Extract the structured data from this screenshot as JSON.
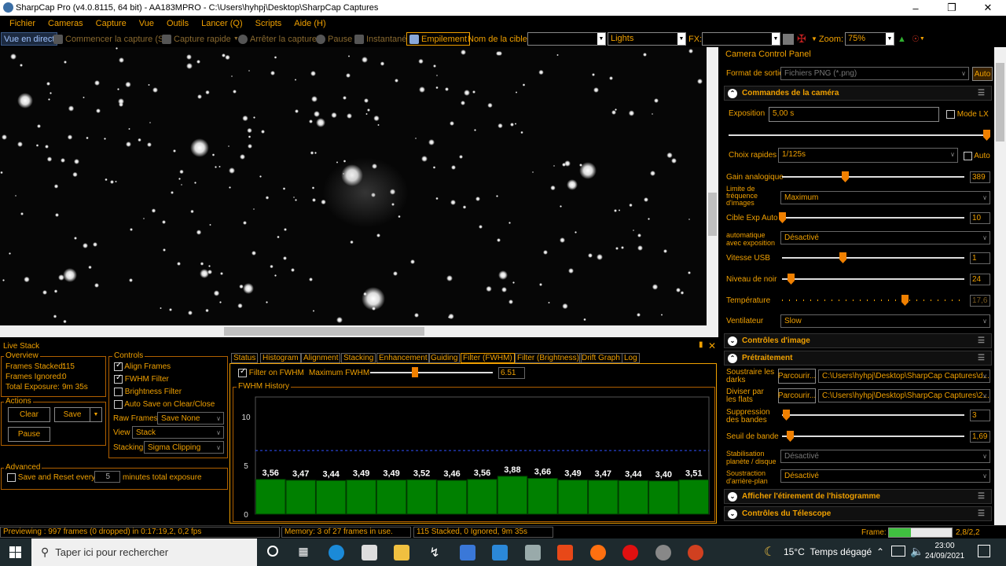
{
  "window": {
    "title": "SharpCap Pro (v4.0.8115, 64 bit)  -  AA183MPRO  -  C:\\Users\\hyhpj\\Desktop\\SharpCap Captures"
  },
  "menu": [
    "Fichier",
    "Cameras",
    "Capture",
    "Vue",
    "Outils",
    "Lancer (Q)",
    "Scripts",
    "Aide (H)"
  ],
  "toolbar": {
    "live_view": "Vue en direct",
    "start_capture": "Commencer la capture (S)",
    "quick_capture": "Capture rapide",
    "stop_capture": "Arrêter la capture",
    "pause": "Pause",
    "snapshot": "Instantané",
    "stacking": "Empilement",
    "target_label": "Nom de la cible:",
    "target_value": "",
    "frame_type": "Lights",
    "fx_label": "FX:",
    "fx_value": "",
    "zoom_label": "Zoom:",
    "zoom_value": "75%"
  },
  "camera_panel": {
    "title": "Camera Control Panel",
    "output_format_label": "Format de sortie",
    "output_format_value": "Fichiers PNG (*.png)",
    "auto_label": "Auto",
    "sections": {
      "camera_controls": "Commandes de la caméra",
      "image_controls": "Contrôles d'image",
      "preprocessing": "Prétraitement",
      "histogram_stretch": "Afficher l'étirement de l'histogramme",
      "telescope_controls": "Contrôles du Télescope"
    },
    "exposure_label": "Exposition",
    "exposure_value": "5,00 s",
    "lx_mode_label": "Mode LX",
    "quick_choice_label": "Choix rapides",
    "quick_choice_value": "1/125s",
    "quick_choice_auto": "Auto",
    "gain_label": "Gain analogique",
    "gain_value": "389",
    "framerate_limit_label": "Limite de fréquence d'images",
    "framerate_limit_value": "Maximum",
    "auto_exp_target_label": "Cible Exp Auto",
    "auto_exp_target_value": "10",
    "auto_with_exposure_label": "automatique avec exposition",
    "auto_with_exposure_value": "Désactivé",
    "usb_speed_label": "Vitesse USB",
    "usb_speed_value": "1",
    "black_level_label": "Niveau de noir",
    "black_level_value": "24",
    "temperature_label": "Température",
    "temperature_value": "17,6",
    "fan_label": "Ventilateur",
    "fan_value": "Slow",
    "subtract_darks_label": "Soustraire les darks",
    "subtract_darks_button": "Parcourir...",
    "subtract_darks_value": "C:\\Users\\hyhpj\\Desktop\\SharpCap Captures\\d...",
    "divide_flats_label": "Diviser par les flats",
    "divide_flats_button": "Parcourir...",
    "divide_flats_value": "C:\\Users\\hyhpj\\Desktop\\SharpCap Captures\\2...",
    "banding_suppression_label": "Suppression des bandes",
    "banding_suppression_value": "3",
    "band_threshold_label": "Seuil de bande",
    "band_threshold_value": "1,69",
    "stabilisation_label": "Stabilisation planète / disque",
    "stabilisation_value": "Désactivé",
    "background_subtraction_label": "Soustraction d'arrière-plan",
    "background_subtraction_value": "Désactivé"
  },
  "live_stack": {
    "title": "Live Stack",
    "overview_legend": "Overview",
    "frames_stacked_label": "Frames Stacked:",
    "frames_stacked_value": "115",
    "frames_ignored_label": "Frames Ignored:",
    "frames_ignored_value": "0",
    "total_exposure_label": "Total Exposure:",
    "total_exposure_value": "9m 35s",
    "actions_legend": "Actions",
    "clear_button": "Clear",
    "save_button": "Save",
    "pause_button": "Pause",
    "advanced_legend": "Advanced",
    "save_reset_label": "Save and Reset every",
    "save_reset_value": "5",
    "save_reset_suffix": "minutes total exposure",
    "controls_legend": "Controls",
    "align_frames": "Align Frames",
    "fwhm_filter": "FWHM Filter",
    "brightness_filter": "Brightness Filter",
    "auto_save": "Auto Save on Clear/Close",
    "raw_frames_label": "Raw Frames",
    "raw_frames_value": "Save None",
    "view_label": "View",
    "view_value": "Stack",
    "stacking_label": "Stacking",
    "stacking_value": "Sigma Clipping",
    "tabs": [
      "Status",
      "Histogram",
      "Alignment",
      "Stacking",
      "Enhancement",
      "Guiding",
      "Filter (FWHM)",
      "Filter (Brightness)",
      "Drift Graph",
      "Log"
    ],
    "active_tab": "Filter (FWHM)",
    "filter_on_fwhm": "Filter on FWHM",
    "max_fwhm_label": "Maximum FWHM",
    "max_fwhm_value": "6.51",
    "history_legend": "FWHM History"
  },
  "chart_data": {
    "type": "bar",
    "title": "FWHM History",
    "yticks": [
      "10",
      "5",
      "0"
    ],
    "ylim": [
      0,
      12
    ],
    "threshold": 6.51,
    "values": [
      3.56,
      3.47,
      3.44,
      3.49,
      3.49,
      3.52,
      3.46,
      3.56,
      3.88,
      3.66,
      3.49,
      3.47,
      3.44,
      3.4,
      3.51
    ],
    "labels": [
      "3,56",
      "3,47",
      "3,44",
      "3,49",
      "3,49",
      "3,52",
      "3,46",
      "3,56",
      "3,88",
      "3,66",
      "3,49",
      "3,47",
      "3,44",
      "3,40",
      "3,51"
    ],
    "bar_color": "#008000",
    "threshold_color": "#3050ff"
  },
  "status_bar": {
    "previewing": "Previewing : 997 frames (0 dropped) in 0:17:19,2, 0,2 fps",
    "memory": "Memory: 3 of 27 frames in use.",
    "stacked": "115 Stacked, 0 Ignored, 9m 35s",
    "frame_label": "Frame:",
    "frame_value": "2,8/2,2",
    "frame_progress": 0.35
  },
  "taskbar": {
    "search_placeholder": "Taper ici pour rechercher",
    "weather_temp": "15°C",
    "weather_text": "Temps dégagé",
    "time": "23:00",
    "date": "24/09/2021"
  },
  "colors": {
    "accent": "#f0a000",
    "background": "#000000",
    "bar": "#008000"
  }
}
